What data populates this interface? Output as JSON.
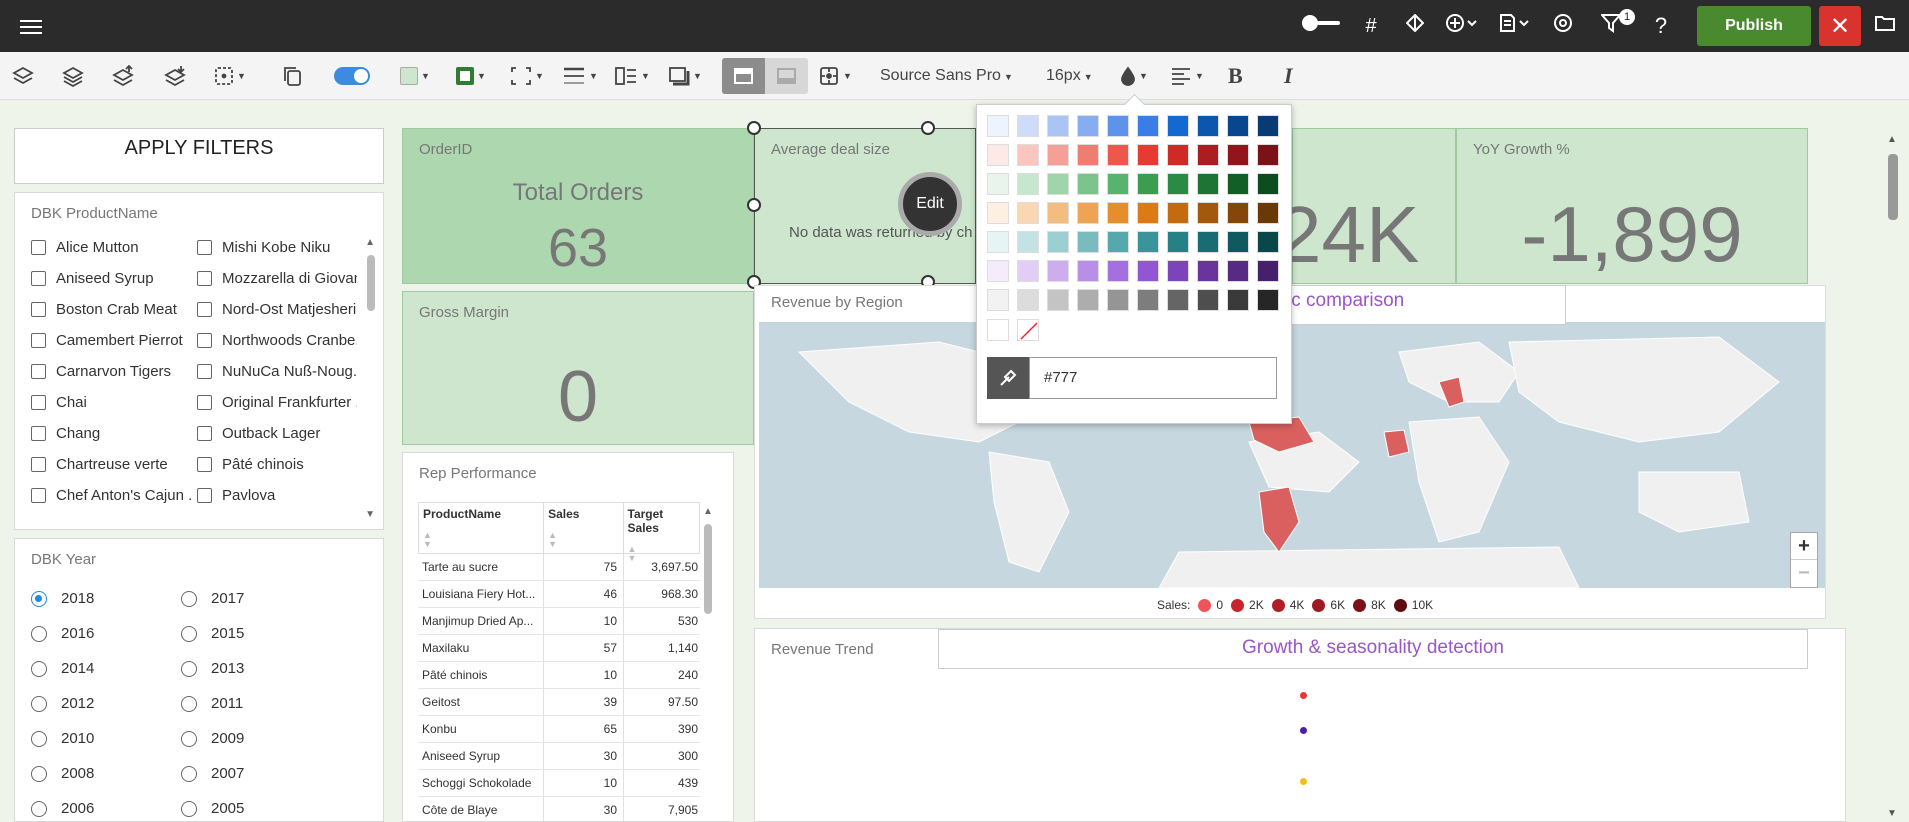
{
  "topbar": {
    "publish_label": "Publish",
    "filter_badge": "1"
  },
  "toolbar": {
    "font_family": "Source Sans Pro",
    "font_size": "16px",
    "fill_color": "#cde6cd",
    "border_color": "#2e7d32"
  },
  "filters": {
    "apply_label": "APPLY FILTERS",
    "product": {
      "title": "DBK ProductName",
      "col1": [
        "Alice Mutton",
        "Aniseed Syrup",
        "Boston Crab Meat",
        "Camembert Pierrot",
        "Carnarvon Tigers",
        "Chai",
        "Chang",
        "Chartreuse verte",
        "Chef Anton's Cajun ..."
      ],
      "col2": [
        "Mishi Kobe Niku",
        "Mozzarella di Giovan",
        "Nord-Ost Matjesheri...",
        "Northwoods Cranbe...",
        "NuNuCa Nuß-Noug...",
        "Original Frankfurter ...",
        "Outback Lager",
        "Pâté chinois",
        "Pavlova"
      ]
    },
    "year": {
      "title": "DBK Year",
      "selected": "2018",
      "col1": [
        "2018",
        "2016",
        "2014",
        "2012",
        "2010",
        "2008",
        "2006"
      ],
      "col2": [
        "2017",
        "2015",
        "2013",
        "2011",
        "2009",
        "2007",
        "2005"
      ]
    }
  },
  "kpis": {
    "orders": {
      "title": "OrderID",
      "subtitle": "Total Orders",
      "value": "63"
    },
    "deal": {
      "title": "Average deal size",
      "message": "No data was returned by ch",
      "edit_label": "Edit"
    },
    "revenue": {
      "value_partial": "24K"
    },
    "yoy": {
      "title": "YoY Growth %",
      "value": "-1,899"
    },
    "margin": {
      "title": "Gross Margin",
      "value": "0"
    }
  },
  "color_picker": {
    "hex_value": "#777",
    "rows": [
      [
        "#eef4fd",
        "#cfdcf9",
        "#a9c5f5",
        "#86adf0",
        "#5e93eb",
        "#3a7de6",
        "#1469d1",
        "#0d56ad",
        "#0a468d",
        "#083a74"
      ],
      [
        "#fde9e7",
        "#f9c6c0",
        "#f4a097",
        "#f07d72",
        "#ec594c",
        "#e63b30",
        "#cf2a25",
        "#ac1d22",
        "#91161c",
        "#7a1217"
      ],
      [
        "#e9f5ec",
        "#c6e6cd",
        "#a0d5ab",
        "#7cc48b",
        "#58b36c",
        "#3c9d52",
        "#2b8a43",
        "#1d7434",
        "#126028",
        "#0c4d20"
      ],
      [
        "#fdf0e2",
        "#f9d7b2",
        "#f3bd82",
        "#eea454",
        "#e88d2c",
        "#dc7a16",
        "#c46a0f",
        "#a4580b",
        "#854709",
        "#6a3907"
      ],
      [
        "#e7f4f4",
        "#c3e2e3",
        "#9ccfd1",
        "#79bcbf",
        "#55a9ad",
        "#39959a",
        "#268186",
        "#196d72",
        "#10595e",
        "#09474b"
      ],
      [
        "#f4ebfb",
        "#e2cdf5",
        "#cdadee",
        "#b98ee7",
        "#a56fdf",
        "#9255d4",
        "#7d43bb",
        "#6a349f",
        "#582a84",
        "#46206a"
      ],
      [
        "#f2f2f2",
        "#dcdcdc",
        "#c4c4c4",
        "#adadad",
        "#959595",
        "#7d7d7d",
        "#656565",
        "#4e4e4e",
        "#3a3a3a",
        "#262626"
      ]
    ]
  },
  "map": {
    "title": "Revenue by Region",
    "highlight": "ic comparison",
    "legend_label": "Sales:",
    "legend": [
      {
        "label": "0",
        "color": "#f0545a"
      },
      {
        "label": "2K",
        "color": "#c9242b"
      },
      {
        "label": "4K",
        "color": "#b11f26"
      },
      {
        "label": "6K",
        "color": "#9c1a21"
      },
      {
        "label": "8K",
        "color": "#7c1118"
      },
      {
        "label": "10K",
        "color": "#5e0b10"
      }
    ],
    "zoom_in": "+",
    "zoom_out": "−"
  },
  "rep": {
    "title": "Rep Performance",
    "headers": [
      "ProductName",
      "Sales",
      "Target Sales"
    ],
    "rows": [
      [
        "Tarte au sucre",
        "75",
        "3,697.50"
      ],
      [
        "Louisiana Fiery Hot...",
        "46",
        "968.30"
      ],
      [
        "Manjimup Dried Ap...",
        "10",
        "530"
      ],
      [
        "Maxilaku",
        "57",
        "1,140"
      ],
      [
        "Pâté chinois",
        "10",
        "240"
      ],
      [
        "Geitost",
        "39",
        "97.50"
      ],
      [
        "Konbu",
        "65",
        "390"
      ],
      [
        "Aniseed Syrup",
        "30",
        "300"
      ],
      [
        "Schoggi Schokolade",
        "10",
        "439"
      ],
      [
        "Côte de Blaye",
        "30",
        "7,905"
      ]
    ]
  },
  "trend": {
    "title": "Revenue Trend",
    "highlight": "Growth & seasonality detection",
    "point_colors": [
      "#e53935",
      "#4a1fa8",
      "#f2c014"
    ]
  }
}
